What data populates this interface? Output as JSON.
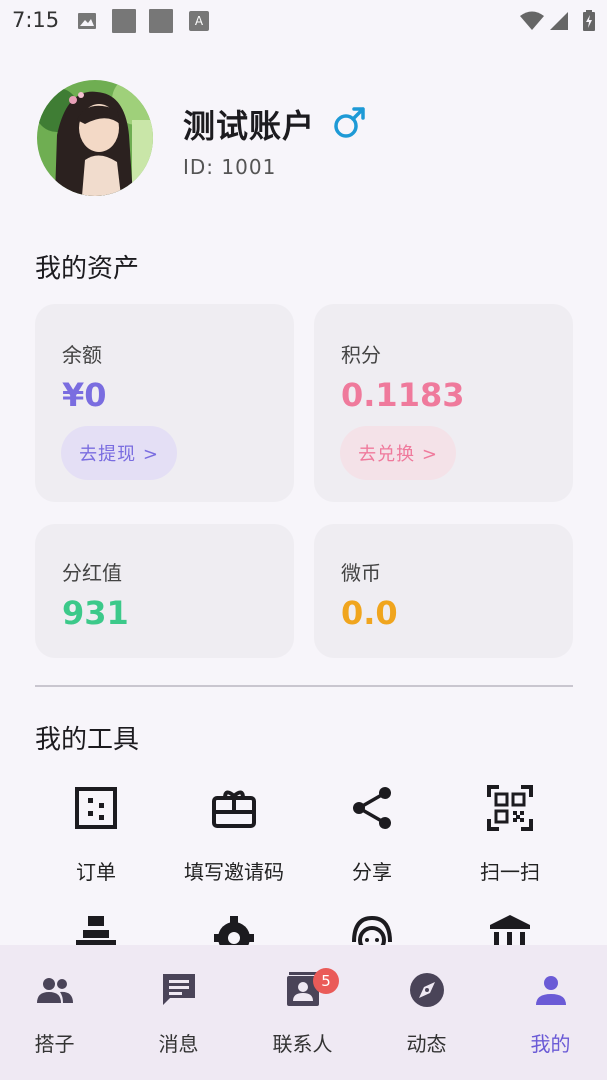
{
  "status_bar": {
    "time": "7:15"
  },
  "profile": {
    "name": "测试账户",
    "id_label": "ID: 1001",
    "gender": "male"
  },
  "assets": {
    "title": "我的资产",
    "balance": {
      "label": "余额",
      "value": "¥0",
      "button": "去提现 >",
      "color": "#7a6de0"
    },
    "points": {
      "label": "积分",
      "value": "0.1183",
      "button": "去兑换 >",
      "color": "#ef7a9c"
    },
    "dividend": {
      "label": "分红值",
      "value": "931",
      "color": "#3cc98a"
    },
    "microcoin": {
      "label": "微币",
      "value": "0.0",
      "color": "#f0a51e"
    }
  },
  "tools": {
    "title": "我的工具",
    "items": [
      {
        "label": "订单",
        "icon": "order-icon"
      },
      {
        "label": "填写邀请码",
        "icon": "gift-icon"
      },
      {
        "label": "分享",
        "icon": "share-icon"
      },
      {
        "label": "扫一扫",
        "icon": "qr-scan-icon"
      }
    ]
  },
  "bottom_nav": {
    "items": [
      {
        "label": "搭子",
        "icon": "group-icon"
      },
      {
        "label": "消息",
        "icon": "message-icon"
      },
      {
        "label": "联系人",
        "icon": "contacts-icon",
        "badge": "5"
      },
      {
        "label": "动态",
        "icon": "compass-icon"
      },
      {
        "label": "我的",
        "icon": "person-icon",
        "active": true
      }
    ]
  }
}
